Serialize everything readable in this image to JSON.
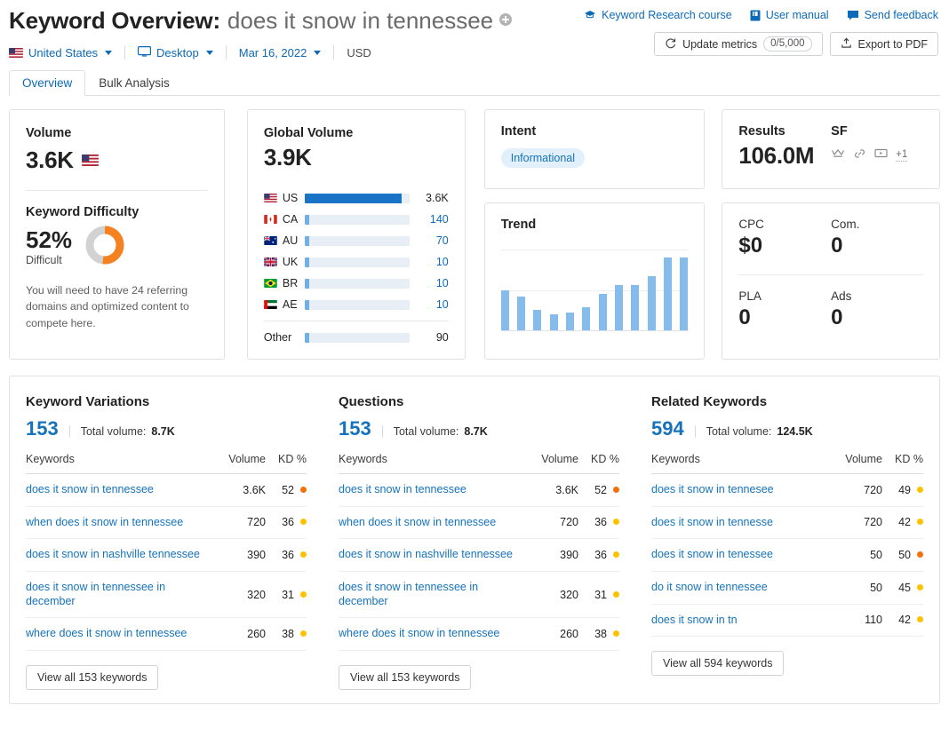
{
  "header": {
    "title_prefix": "Keyword Overview:",
    "keyword": "does it snow in tennessee",
    "add_icon": "plus-circle-icon",
    "links": [
      {
        "label": "Keyword Research course",
        "icon": "graduation-cap-icon"
      },
      {
        "label": "User manual",
        "icon": "book-icon"
      },
      {
        "label": "Send feedback",
        "icon": "speech-bubble-icon"
      }
    ],
    "buttons": {
      "update_metrics": "Update metrics",
      "update_counter": "0/5,000",
      "export_pdf": "Export to PDF"
    }
  },
  "filters": {
    "country": "United States",
    "device": "Desktop",
    "date": "Mar 16, 2022",
    "currency": "USD"
  },
  "tabs": [
    {
      "label": "Overview",
      "active": true
    },
    {
      "label": "Bulk Analysis",
      "active": false
    }
  ],
  "volume_card": {
    "label": "Volume",
    "value": "3.6K",
    "kd_label": "Keyword Difficulty",
    "kd_value": "52%",
    "kd_percent": 52,
    "kd_status": "Difficult",
    "kd_note": "You will need to have 24 referring domains and optimized content to compete here.",
    "kd_color": "#f58220",
    "kd_track_color": "#d2d2d2"
  },
  "global_volume": {
    "label": "Global Volume",
    "value": "3.9K",
    "rows": [
      {
        "code": "US",
        "value": "3.6K",
        "pct": 93,
        "main": true
      },
      {
        "code": "CA",
        "value": "140",
        "pct": 4,
        "main": false
      },
      {
        "code": "AU",
        "value": "70",
        "pct": 4,
        "main": false
      },
      {
        "code": "UK",
        "value": "10",
        "pct": 4,
        "main": false
      },
      {
        "code": "BR",
        "value": "10",
        "pct": 4,
        "main": false
      },
      {
        "code": "AE",
        "value": "10",
        "pct": 4,
        "main": false
      }
    ],
    "other": {
      "label": "Other",
      "value": "90",
      "pct": 4
    }
  },
  "intent": {
    "label": "Intent",
    "value": "Informational"
  },
  "trend": {
    "label": "Trend"
  },
  "results": {
    "label": "Results",
    "value": "106.0M",
    "sf_label": "SF",
    "sf_icons": [
      "crown-icon",
      "link-icon",
      "video-icon"
    ],
    "sf_more": "+1"
  },
  "cpc_card": {
    "metrics": [
      {
        "label": "CPC",
        "value": "$0"
      },
      {
        "label": "Com.",
        "value": "0"
      },
      {
        "label": "PLA",
        "value": "0"
      },
      {
        "label": "Ads",
        "value": "0"
      }
    ]
  },
  "columns": [
    {
      "title": "Keyword Variations",
      "count": "153",
      "total_volume_label": "Total volume:",
      "total_volume": "8.7K",
      "headers": {
        "keywords": "Keywords",
        "volume": "Volume",
        "kd": "KD %"
      },
      "rows": [
        {
          "keyword": "does it snow in tennessee",
          "volume": "3.6K",
          "kd": "52",
          "color": "#f5700a"
        },
        {
          "keyword": "when does it snow in tennessee",
          "volume": "720",
          "kd": "36",
          "color": "#ffc200"
        },
        {
          "keyword": "does it snow in nashville tennessee",
          "volume": "390",
          "kd": "36",
          "color": "#ffc200"
        },
        {
          "keyword": "does it snow in tennessee in december",
          "volume": "320",
          "kd": "31",
          "color": "#ffc200"
        },
        {
          "keyword": "where does it snow in tennessee",
          "volume": "260",
          "kd": "38",
          "color": "#ffc200"
        }
      ],
      "view_all": "View all 153 keywords"
    },
    {
      "title": "Questions",
      "count": "153",
      "total_volume_label": "Total volume:",
      "total_volume": "8.7K",
      "headers": {
        "keywords": "Keywords",
        "volume": "Volume",
        "kd": "KD %"
      },
      "rows": [
        {
          "keyword": "does it snow in tennessee",
          "volume": "3.6K",
          "kd": "52",
          "color": "#f5700a"
        },
        {
          "keyword": "when does it snow in tennessee",
          "volume": "720",
          "kd": "36",
          "color": "#ffc200"
        },
        {
          "keyword": "does it snow in nashville tennessee",
          "volume": "390",
          "kd": "36",
          "color": "#ffc200"
        },
        {
          "keyword": "does it snow in tennessee in december",
          "volume": "320",
          "kd": "31",
          "color": "#ffc200"
        },
        {
          "keyword": "where does it snow in tennessee",
          "volume": "260",
          "kd": "38",
          "color": "#ffc200"
        }
      ],
      "view_all": "View all 153 keywords"
    },
    {
      "title": "Related Keywords",
      "count": "594",
      "total_volume_label": "Total volume:",
      "total_volume": "124.5K",
      "headers": {
        "keywords": "Keywords",
        "volume": "Volume",
        "kd": "KD %"
      },
      "rows": [
        {
          "keyword": "does it snow in tennesee",
          "volume": "720",
          "kd": "49",
          "color": "#ffc200"
        },
        {
          "keyword": "does it snow in tennesse",
          "volume": "720",
          "kd": "42",
          "color": "#ffc200"
        },
        {
          "keyword": "does it snow in tenessee",
          "volume": "50",
          "kd": "50",
          "color": "#f5700a"
        },
        {
          "keyword": "do it snow in tennessee",
          "volume": "50",
          "kd": "45",
          "color": "#ffc200"
        },
        {
          "keyword": "does it snow in tn",
          "volume": "110",
          "kd": "42",
          "color": "#ffc200"
        }
      ],
      "view_all": "View all 594 keywords"
    }
  ],
  "chart_data": {
    "type": "bar",
    "title": "Trend",
    "categories": [
      "1",
      "2",
      "3",
      "4",
      "5",
      "6",
      "7",
      "8",
      "9",
      "10",
      "11",
      "12"
    ],
    "values": [
      55,
      46,
      28,
      22,
      25,
      32,
      50,
      62,
      62,
      74,
      100,
      100
    ],
    "ylim": [
      0,
      100
    ],
    "xlabel": "",
    "ylabel": "",
    "grid": true,
    "legend": "none",
    "bar_color": "#86bceb"
  }
}
